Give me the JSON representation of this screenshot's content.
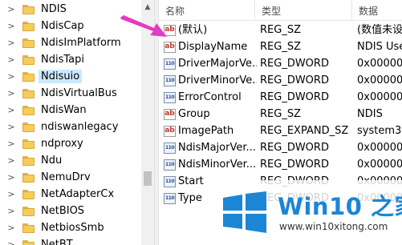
{
  "tree": {
    "items": [
      {
        "label": "NDIS",
        "selected": false
      },
      {
        "label": "NdisCap",
        "selected": false
      },
      {
        "label": "NdisImPlatform",
        "selected": false
      },
      {
        "label": "NdisTapi",
        "selected": false
      },
      {
        "label": "Ndisuio",
        "selected": true
      },
      {
        "label": "NdisVirtualBus",
        "selected": false
      },
      {
        "label": "NdisWan",
        "selected": false
      },
      {
        "label": "ndiswanlegacy",
        "selected": false
      },
      {
        "label": "ndproxy",
        "selected": false
      },
      {
        "label": "Ndu",
        "selected": false
      },
      {
        "label": "NemuDrv",
        "selected": false
      },
      {
        "label": "NetAdapterCx",
        "selected": false
      },
      {
        "label": "NetBIOS",
        "selected": false
      },
      {
        "label": "NetbiosSmb",
        "selected": false
      },
      {
        "label": "NetBT",
        "selected": false
      }
    ],
    "expander_glyph": ">"
  },
  "values": {
    "headers": {
      "name": "名称",
      "type": "类型",
      "data": "数据"
    },
    "rows": [
      {
        "icon": "reg-sz-icon",
        "name": "(默认)",
        "type": "REG_SZ",
        "data": "(数值未设"
      },
      {
        "icon": "reg-sz-icon",
        "name": "DisplayName",
        "type": "REG_SZ",
        "data": "NDIS Use"
      },
      {
        "icon": "reg-dword-icon",
        "name": "DriverMajorVe...",
        "type": "REG_DWORD",
        "data": "0x000000"
      },
      {
        "icon": "reg-dword-icon",
        "name": "DriverMinorVe...",
        "type": "REG_DWORD",
        "data": "0x000000"
      },
      {
        "icon": "reg-dword-icon",
        "name": "ErrorControl",
        "type": "REG_DWORD",
        "data": "0x000000"
      },
      {
        "icon": "reg-sz-icon",
        "name": "Group",
        "type": "REG_SZ",
        "data": "NDIS"
      },
      {
        "icon": "reg-sz-icon",
        "name": "ImagePath",
        "type": "REG_EXPAND_SZ",
        "data": "system32"
      },
      {
        "icon": "reg-dword-icon",
        "name": "NdisMajorVer...",
        "type": "REG_DWORD",
        "data": "0x000000"
      },
      {
        "icon": "reg-dword-icon",
        "name": "NdisMinorVer...",
        "type": "REG_DWORD",
        "data": "0x000000"
      },
      {
        "icon": "reg-dword-icon",
        "name": "Start",
        "type": "REG_DWORD",
        "data": "0x000000"
      },
      {
        "icon": "reg-dword-icon",
        "name": "Type",
        "type": "REG_DWORD",
        "data": "0x000000"
      }
    ]
  },
  "watermark": {
    "title": "Win10 之家",
    "url": "www.win10xitong.com"
  },
  "colors": {
    "arrow": "#e23cc0",
    "selection": "#cce8ff",
    "brand_blue": "#1c86d4"
  }
}
